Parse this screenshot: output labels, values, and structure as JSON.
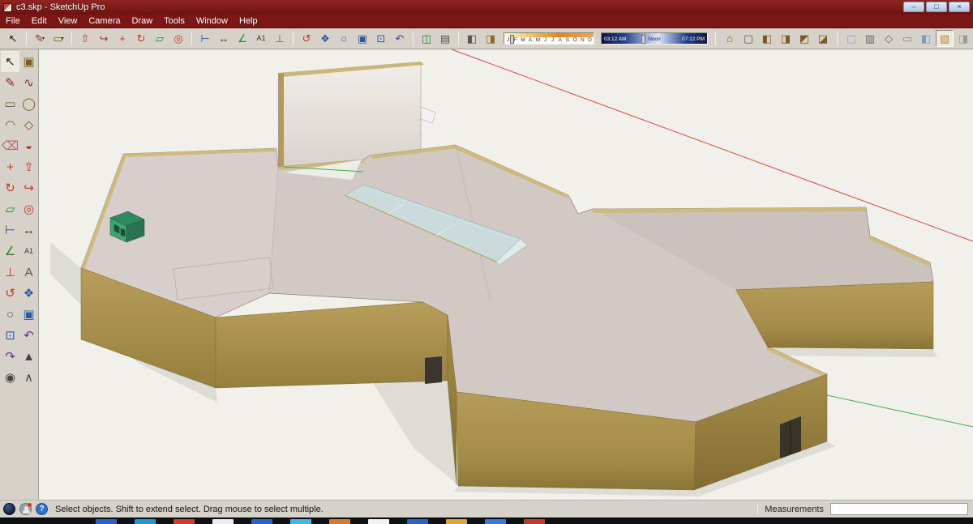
{
  "window": {
    "title": "c3.skp - SketchUp Pro",
    "controls": [
      {
        "name": "minimize-button",
        "glyph": "–"
      },
      {
        "name": "maximize-button",
        "glyph": "□"
      },
      {
        "name": "close-button",
        "glyph": "×"
      }
    ]
  },
  "menu": {
    "items": [
      "File",
      "Edit",
      "View",
      "Camera",
      "Draw",
      "Tools",
      "Window",
      "Help"
    ]
  },
  "toolbar": {
    "groups": [
      {
        "name": "select",
        "icons": [
          {
            "name": "select-tool",
            "glyph": "↖",
            "color": "#1a1a1a"
          }
        ]
      },
      {
        "name": "draw",
        "icons": [
          {
            "name": "line-tool",
            "glyph": "✎",
            "color": "#8a2b20",
            "dropdown": true
          },
          {
            "name": "shapes-tool",
            "glyph": "▭",
            "color": "#7a5c20",
            "dropdown": true
          }
        ]
      },
      {
        "name": "modify",
        "icons": [
          {
            "name": "push-pull-tool",
            "glyph": "⇧",
            "color": "#b03a2a"
          },
          {
            "name": "follow-me-tool",
            "glyph": "↪",
            "color": "#b03a2a"
          },
          {
            "name": "move-tool",
            "glyph": "+",
            "color": "#c0392b"
          },
          {
            "name": "rotate-tool",
            "glyph": "↻",
            "color": "#c0392b"
          },
          {
            "name": "scale-tool",
            "glyph": "▱",
            "color": "#2e7d32"
          },
          {
            "name": "offset-tool",
            "glyph": "◎",
            "color": "#c0392b"
          }
        ]
      },
      {
        "name": "construction",
        "icons": [
          {
            "name": "tape-measure-tool",
            "glyph": "⊢",
            "color": "#2c5aa0"
          },
          {
            "name": "dimension-tool",
            "glyph": "↔",
            "color": "#333333"
          },
          {
            "name": "protractor-tool",
            "glyph": "∠",
            "color": "#2e7d32"
          },
          {
            "name": "text-tool",
            "glyph": "A1",
            "color": "#333333"
          },
          {
            "name": "axes-tool",
            "glyph": "⊥",
            "color": "#c0392b"
          }
        ]
      },
      {
        "name": "camera",
        "icons": [
          {
            "name": "orbit-tool",
            "glyph": "↺",
            "color": "#c0392b"
          },
          {
            "name": "pan-tool",
            "glyph": "❖",
            "color": "#2c5aa0"
          },
          {
            "name": "zoom-tool",
            "glyph": "○",
            "color": "#2c5aa0"
          },
          {
            "name": "zoom-window-tool",
            "glyph": "▣",
            "color": "#2c5aa0"
          },
          {
            "name": "zoom-extents-tool",
            "glyph": "⊡",
            "color": "#2c5aa0"
          },
          {
            "name": "previous-view-tool",
            "glyph": "↶",
            "color": "#6a329f"
          }
        ]
      },
      {
        "name": "section",
        "icons": [
          {
            "name": "section-plane-tool",
            "glyph": "◫",
            "color": "#2e7d32"
          },
          {
            "name": "section-cuts-toggle",
            "glyph": "▤",
            "color": "#555555"
          }
        ]
      },
      {
        "name": "shadow",
        "icons": [
          {
            "name": "shadow-settings",
            "glyph": "◧",
            "color": "#555555"
          },
          {
            "name": "shadow-toggle",
            "glyph": "◨",
            "color": "#8a6d1f"
          }
        ]
      }
    ],
    "views": [
      {
        "name": "view-iso",
        "glyph": "⌂",
        "color": "#7a5c20"
      },
      {
        "name": "view-top",
        "glyph": "▢",
        "color": "#555555"
      },
      {
        "name": "view-front",
        "glyph": "◧",
        "color": "#7a5c20"
      },
      {
        "name": "view-right",
        "glyph": "◨",
        "color": "#7a5c20"
      },
      {
        "name": "view-back",
        "glyph": "◩",
        "color": "#7a5c20"
      },
      {
        "name": "view-left",
        "glyph": "◪",
        "color": "#7a5c20"
      }
    ],
    "styles": [
      {
        "name": "style-xray",
        "glyph": "▢",
        "color": "#88a0b8"
      },
      {
        "name": "style-back-edges",
        "glyph": "▥",
        "color": "#666666"
      },
      {
        "name": "style-wireframe",
        "glyph": "◇",
        "color": "#666666"
      },
      {
        "name": "style-hidden-line",
        "glyph": "▭",
        "color": "#888888"
      },
      {
        "name": "style-shaded",
        "glyph": "◧",
        "color": "#7a9cc0"
      },
      {
        "name": "style-shaded-textures",
        "glyph": "▨",
        "color": "#b08a40",
        "pressed": true
      },
      {
        "name": "style-monochrome",
        "glyph": "◨",
        "color": "#999999"
      }
    ]
  },
  "shadow_control": {
    "months": [
      "J",
      "F",
      "M",
      "A",
      "M",
      "J",
      "J",
      "A",
      "S",
      "O",
      "N",
      "D"
    ],
    "time_start": "03:12 AM",
    "time_noon": "Noon",
    "time_end": "07:12 PM"
  },
  "palette": {
    "tools": [
      {
        "name": "select-tool",
        "glyph": "↖",
        "color": "#1a1a1a",
        "pressed": true
      },
      {
        "name": "make-component-tool",
        "glyph": "▣",
        "color": "#7a5c20"
      },
      {
        "name": "line-tool",
        "glyph": "✎",
        "color": "#8a2b20"
      },
      {
        "name": "freehand-tool",
        "glyph": "∿",
        "color": "#8a2b20"
      },
      {
        "name": "rectangle-tool",
        "glyph": "▭",
        "color": "#7a5c20"
      },
      {
        "name": "circle-tool",
        "glyph": "◯",
        "color": "#7a5c20"
      },
      {
        "name": "arc-tool",
        "glyph": "◠",
        "color": "#7a5c20"
      },
      {
        "name": "polygon-tool",
        "glyph": "◇",
        "color": "#7a5c20"
      },
      {
        "name": "eraser-tool",
        "glyph": "⌫",
        "color": "#b5646e"
      },
      {
        "name": "paint-bucket-tool",
        "glyph": "◒",
        "color": "#b03a2a"
      },
      {
        "name": "move-tool",
        "glyph": "+",
        "color": "#c0392b"
      },
      {
        "name": "push-pull-tool",
        "glyph": "⇧",
        "color": "#c0392b"
      },
      {
        "name": "rotate-tool",
        "glyph": "↻",
        "color": "#c0392b"
      },
      {
        "name": "follow-me-tool",
        "glyph": "↪",
        "color": "#c0392b"
      },
      {
        "name": "scale-tool",
        "glyph": "▱",
        "color": "#2e7d32"
      },
      {
        "name": "offset-tool",
        "glyph": "◎",
        "color": "#c0392b"
      },
      {
        "name": "tape-measure-tool",
        "glyph": "⊢",
        "color": "#2c5aa0"
      },
      {
        "name": "dimension-tool",
        "glyph": "↔",
        "color": "#333333"
      },
      {
        "name": "protractor-tool",
        "glyph": "∠",
        "color": "#2e7d32"
      },
      {
        "name": "text-tool",
        "glyph": "A1",
        "color": "#333333"
      },
      {
        "name": "axes-tool",
        "glyph": "⊥",
        "color": "#c0392b"
      },
      {
        "name": "3d-text-tool",
        "glyph": "A",
        "color": "#555555"
      },
      {
        "name": "orbit-tool",
        "glyph": "↺",
        "color": "#c0392b"
      },
      {
        "name": "pan-tool",
        "glyph": "❖",
        "color": "#2c5aa0"
      },
      {
        "name": "zoom-tool",
        "glyph": "○",
        "color": "#2c5aa0"
      },
      {
        "name": "zoom-window-tool",
        "glyph": "▣",
        "color": "#2c5aa0"
      },
      {
        "name": "zoom-extents-tool",
        "glyph": "⊡",
        "color": "#2c5aa0"
      },
      {
        "name": "previous-view-tool",
        "glyph": "↶",
        "color": "#6a329f"
      },
      {
        "name": "next-view-tool",
        "glyph": "↷",
        "color": "#6a329f"
      },
      {
        "name": "position-camera-tool",
        "glyph": "▲",
        "color": "#444444"
      },
      {
        "name": "look-around-tool",
        "glyph": "◉",
        "color": "#444444"
      },
      {
        "name": "walk-tool",
        "glyph": "∧",
        "color": "#444444"
      }
    ]
  },
  "viewport": {
    "colors": {
      "roof": "#d2c8c4",
      "parapet": "#cdbb7e",
      "ground": "#f2f0eb",
      "shadow": "#dddcd5",
      "glass": "#cadcdd",
      "hut": "#3da575",
      "axis-red": "#e0463a",
      "axis-green": "#3fae49"
    }
  },
  "statusbar": {
    "hint": "Select objects. Shift to extend select. Drag mouse to select multiple.",
    "measurements_label": "Measurements",
    "measurements_value": ""
  },
  "taskbar": {
    "chips": [
      "#2a63c4",
      "#1d9bd1",
      "#d63a2f",
      "#e8eef5",
      "#2a63c4",
      "#45b6e0",
      "#d9792c",
      "#f2f2f2",
      "#2a63c4",
      "#e0a23c",
      "#3c78d8",
      "#c43a2a"
    ]
  }
}
